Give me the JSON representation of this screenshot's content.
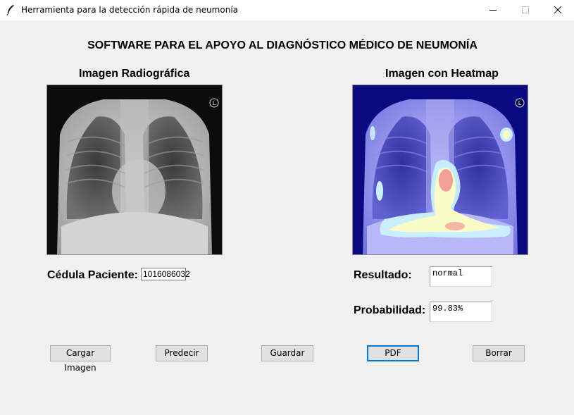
{
  "window": {
    "title": "Herramienta para la detección rápida de neumonía",
    "icon": "feather-icon"
  },
  "header": {
    "title": "SOFTWARE PARA EL APOYO AL DIAGNÓSTICO MÉDICO DE NEUMONÍA"
  },
  "images": {
    "left_label": "Imagen Radiográfica",
    "right_label": "Imagen con Heatmap",
    "marker": "L"
  },
  "form": {
    "cedula_label": "Cédula Paciente:",
    "cedula_value": "1016086032",
    "resultado_label": "Resultado:",
    "resultado_value": "normal",
    "probabilidad_label": "Probabilidad:",
    "probabilidad_value": "99.83%"
  },
  "buttons": {
    "cargar": "Cargar Imagen",
    "predecir": "Predecir",
    "guardar": "Guardar",
    "pdf": "PDF",
    "borrar": "Borrar"
  },
  "colors": {
    "background": "#f0f0f0",
    "focus": "#0078d7"
  }
}
